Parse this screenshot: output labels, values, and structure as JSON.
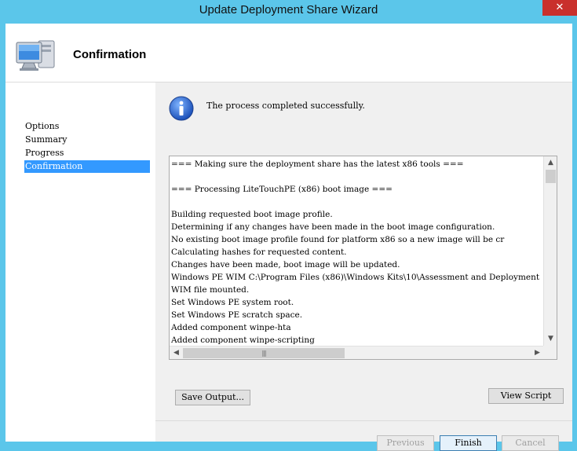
{
  "window": {
    "title": "Update Deployment Share Wizard",
    "close_label": "✕"
  },
  "header": {
    "title": "Confirmation",
    "icon": "computer-icon"
  },
  "sidebar": {
    "items": [
      {
        "label": "Options"
      },
      {
        "label": "Summary"
      },
      {
        "label": "Progress"
      },
      {
        "label": "Confirmation",
        "selected": true
      }
    ]
  },
  "main": {
    "status_icon": "info-icon",
    "status_text": "The process completed successfully.",
    "log_lines": [
      "=== Making sure the deployment share has the latest x86 tools ===",
      "",
      "=== Processing LiteTouchPE (x86) boot image ===",
      "",
      "Building requested boot image profile.",
      "Determining if any changes have been made in the boot image configuration.",
      "No existing boot image profile found for platform x86 so a new image will be cr",
      "Calculating hashes for requested content.",
      "Changes have been made, boot image will be updated.",
      "Windows PE WIM C:\\Program Files (x86)\\Windows Kits\\10\\Assessment and Deployment",
      "WIM file mounted.",
      "Set Windows PE system root.",
      "Set Windows PE scratch space.",
      "Added component winpe-hta",
      "Added component winpe-scripting"
    ],
    "save_output_label": "Save Output...",
    "view_script_label": "View Script"
  },
  "footer": {
    "previous_label": "Previous",
    "finish_label": "Finish",
    "cancel_label": "Cancel"
  },
  "colors": {
    "frame": "#5bc6ea",
    "selection": "#3399ff",
    "close": "#c9302c"
  }
}
